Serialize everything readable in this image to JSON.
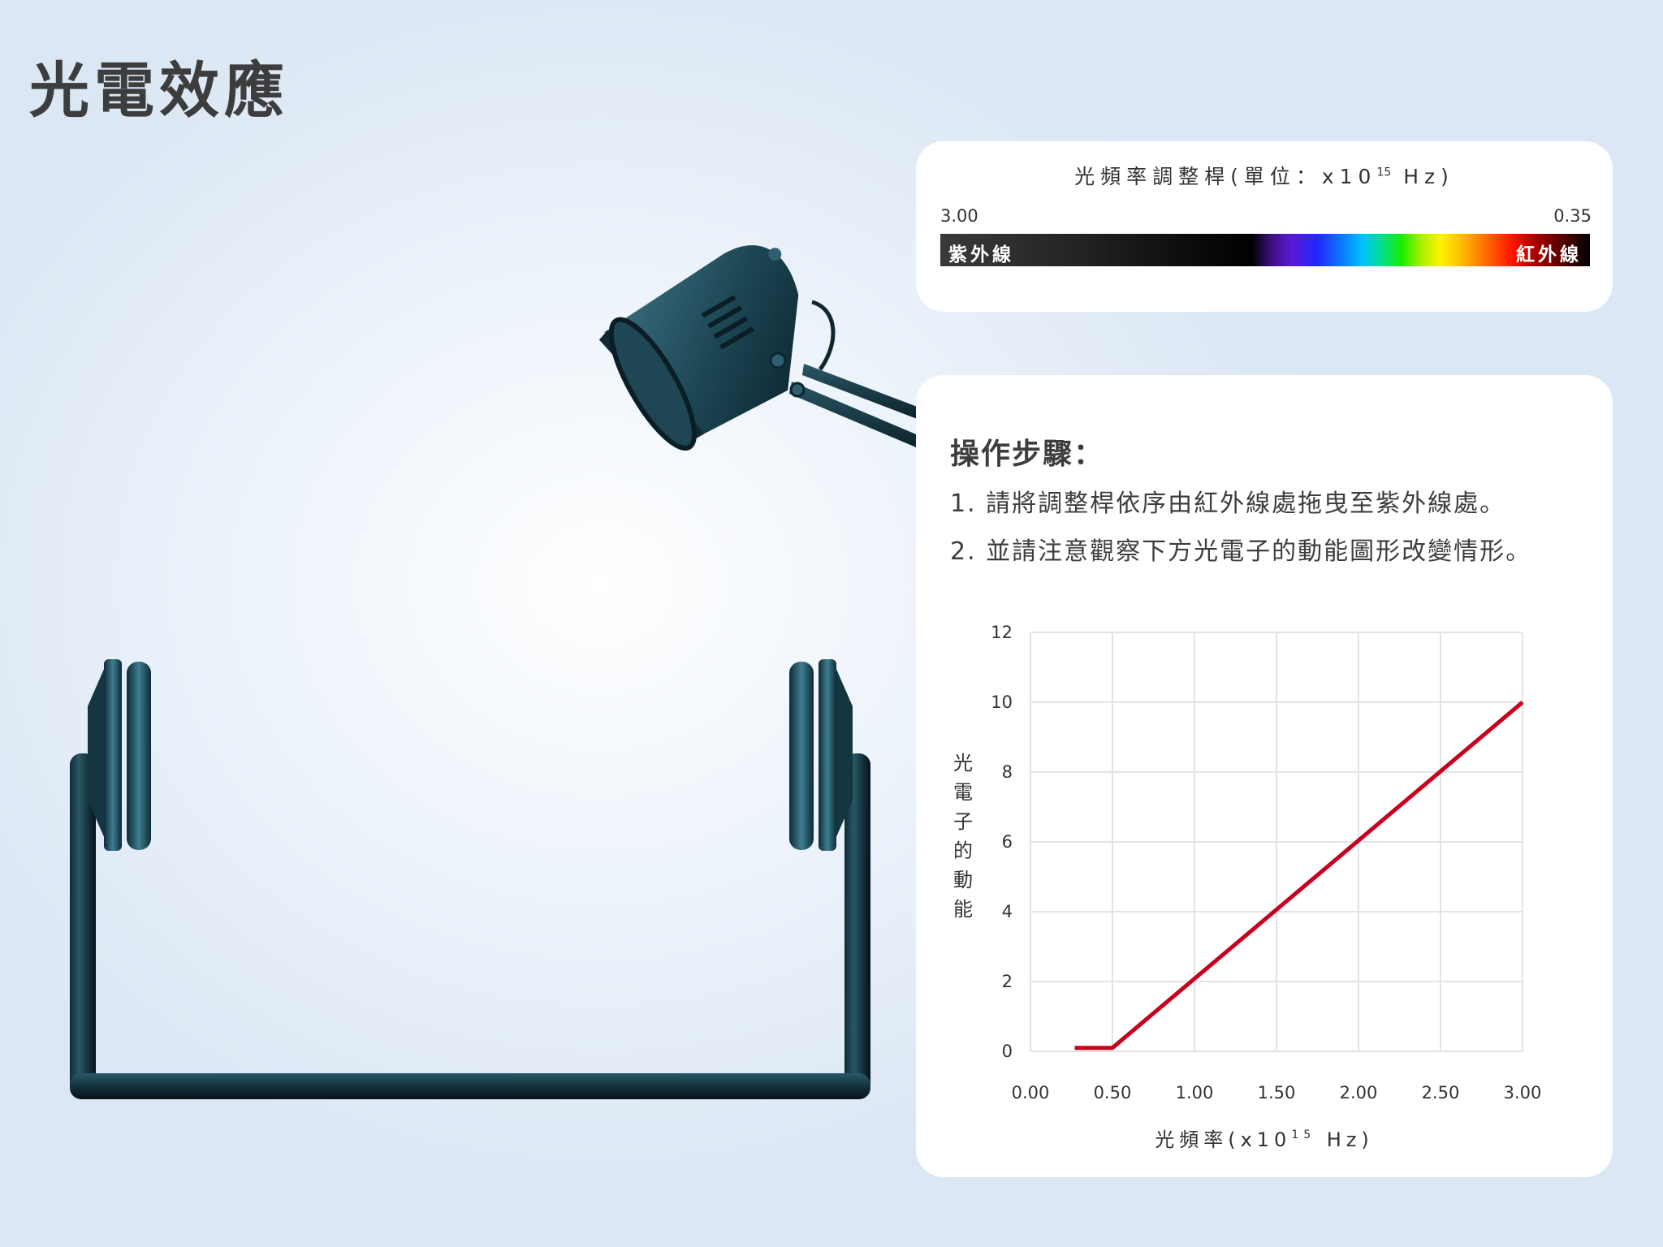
{
  "page": {
    "title": "光電效應"
  },
  "slider": {
    "title": "光頻率調整桿(單位：x10",
    "title_exp": "15",
    "title_unit": " Hz)",
    "left_value": "3.00",
    "right_value": "0.35",
    "uv_label": "紫外線",
    "ir_label": "紅外線",
    "current_value": 0.35
  },
  "instructions": {
    "heading": "操作步驟：",
    "step1": "1. 請將調整桿依序由紅外線處拖曳至紫外線處。",
    "step2": "2. 並請注意觀察下方光電子的動能圖形改變情形。"
  },
  "colors": {
    "line": "#c8001e",
    "apparatus": "#1c4553",
    "spectrum_uv": "#3a3a3a",
    "spectrum_ir": "#000000"
  },
  "chart_data": {
    "type": "line",
    "xlabel": "光頻率(x10",
    "xlabel_exp": "15",
    "xlabel_unit": " Hz)",
    "ylabel": "光電子的動能",
    "x_ticks": [
      "0.00",
      "0.50",
      "1.00",
      "1.50",
      "2.00",
      "2.50",
      "3.00"
    ],
    "y_ticks": [
      "0",
      "2",
      "4",
      "6",
      "8",
      "10",
      "12"
    ],
    "xlim": [
      0,
      3
    ],
    "ylim": [
      0,
      12
    ],
    "grid": true,
    "series": [
      {
        "x": [
          0.27,
          0.5,
          3.0
        ],
        "y": [
          0.1,
          0.1,
          10.0
        ]
      }
    ]
  }
}
